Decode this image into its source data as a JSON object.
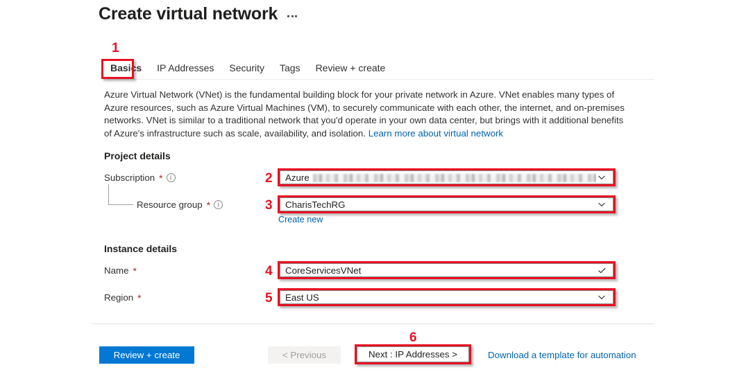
{
  "header": {
    "title": "Create virtual network",
    "more_menu": "..."
  },
  "tabs": [
    {
      "label": "Basics",
      "active": true
    },
    {
      "label": "IP Addresses",
      "active": false
    },
    {
      "label": "Security",
      "active": false
    },
    {
      "label": "Tags",
      "active": false
    },
    {
      "label": "Review + create",
      "active": false
    }
  ],
  "description": {
    "text": "Azure Virtual Network (VNet) is the fundamental building block for your private network in Azure. VNet enables many types of Azure resources, such as Azure Virtual Machines (VM), to securely communicate with each other, the internet, and on-premises networks. VNet is similar to a traditional network that you'd operate in your own data center, but brings with it additional benefits of Azure's infrastructure such as scale, availability, and isolation. ",
    "link_label": "Learn more about virtual network"
  },
  "project_details": {
    "heading": "Project details",
    "subscription": {
      "label": "Subscription",
      "required": "*",
      "info_icon": "info-icon",
      "value_prefix": "Azure",
      "value_redacted": true,
      "control_icon": "chevron-down-icon"
    },
    "resource_group": {
      "label": "Resource group",
      "required": "*",
      "info_icon": "info-icon",
      "value": "CharisTechRG",
      "control_icon": "chevron-down-icon",
      "create_new_label": "Create new"
    }
  },
  "instance_details": {
    "heading": "Instance details",
    "name": {
      "label": "Name",
      "required": "*",
      "value": "CoreServicesVNet",
      "control_icon": "checkmark-icon"
    },
    "region": {
      "label": "Region",
      "required": "*",
      "value": "East US",
      "control_icon": "chevron-down-icon"
    }
  },
  "footer": {
    "review_create_label": "Review + create",
    "previous_label": "< Previous",
    "next_label": "Next : IP Addresses >",
    "download_label": "Download a template for automation"
  },
  "annotations": {
    "n1": "1",
    "n2": "2",
    "n3": "3",
    "n4": "4",
    "n5": "5",
    "n6": "6"
  },
  "colors": {
    "annotation_red": "#e81123",
    "azure_blue": "#0078d4",
    "link_blue": "#0063b1",
    "required_red": "#a4262c"
  }
}
